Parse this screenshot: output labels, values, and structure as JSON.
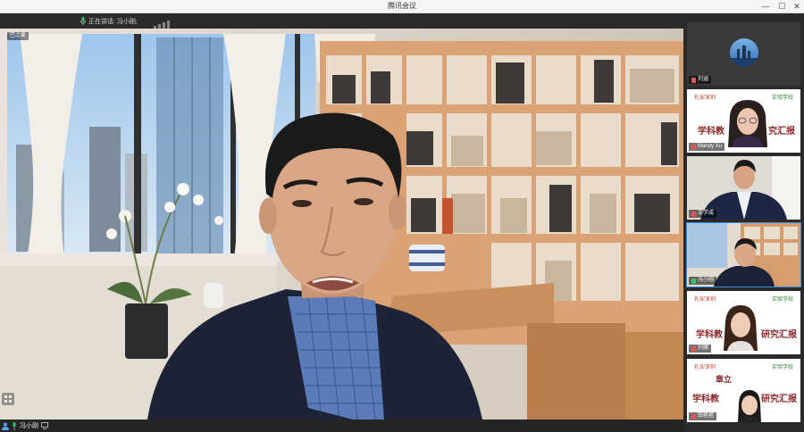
{
  "window": {
    "title": "腾讯会议",
    "controls": {
      "minimize": "—",
      "maximize": "☐",
      "close": "✕"
    }
  },
  "topstrip": {
    "speaking_text": "正在讲话: 冯小刚;"
  },
  "main_video": {
    "local_label": "已上麦"
  },
  "bottombar": {
    "name": "冯小刚"
  },
  "sidebar": {
    "tiles": [
      {
        "name": "刘涵",
        "type": "avatar"
      },
      {
        "name": "Mandy Xu",
        "type": "slide",
        "slide_lines": [
          "礼安深圳",
          "实验学校",
          "学科教",
          "究汇报"
        ]
      },
      {
        "name": "王学成",
        "type": "person"
      },
      {
        "name": "冯小刚",
        "type": "bookshelf",
        "active": true
      },
      {
        "name": "刘娜",
        "type": "slide",
        "slide_lines": [
          "礼安深圳",
          "实验学校",
          "学科教",
          "研究汇报"
        ]
      },
      {
        "name": "田艳艳",
        "type": "slide",
        "slide_lines": [
          "礼安深圳",
          "实验学校",
          "章立",
          "学科教",
          "研究汇报"
        ]
      }
    ]
  },
  "colors": {
    "accent": "#3a8ee6",
    "mic_active": "#35c46a",
    "dark": "#252525"
  }
}
